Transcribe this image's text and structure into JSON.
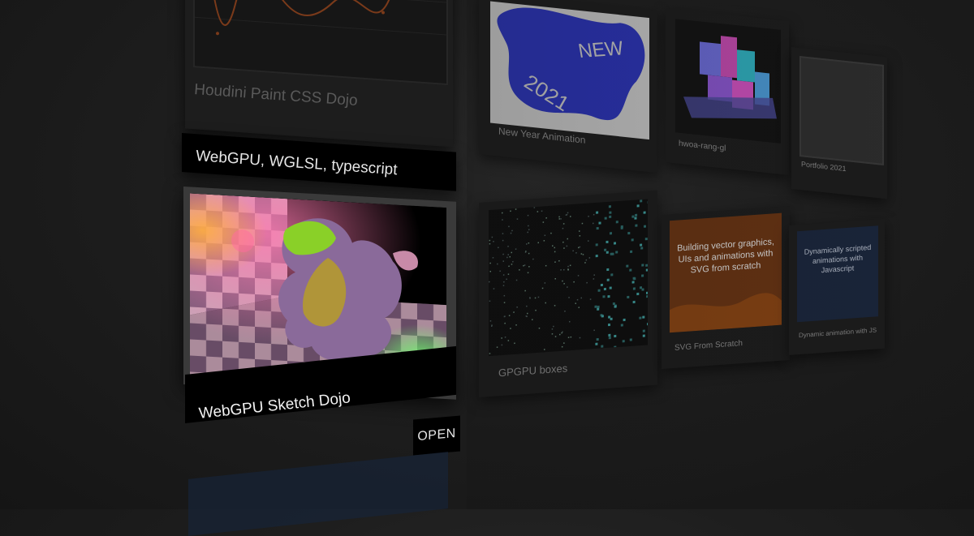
{
  "gallery": {
    "left_column": {
      "top_card_title": "Houdini Paint CSS Dojo",
      "tags": "WebGPU, WGLSL, typescript",
      "featured_title": "WebGPU Sketch Dojo",
      "open_label": "OPEN"
    },
    "grid": [
      {
        "title": "New Year Animation",
        "thumb_text_1": "NEW",
        "thumb_text_2": "2021"
      },
      {
        "title": "hwoa-rang-gl"
      },
      {
        "title": "Portfolio 2021"
      },
      {
        "title": "GPGPU boxes"
      },
      {
        "title": "SVG From Scratch",
        "thumb_text": "Building vector graphics, UIs and animations with SVG from scratch"
      },
      {
        "title": "Dynamic animation with JS",
        "thumb_text": "Dynamically scripted animations with Javascript"
      }
    ]
  },
  "colors": {
    "background": "#1e1e1e",
    "new_year_blob": "#2a33b8",
    "svg_card_orange": "#a0501a",
    "js_card_navy": "#1c2a44"
  }
}
